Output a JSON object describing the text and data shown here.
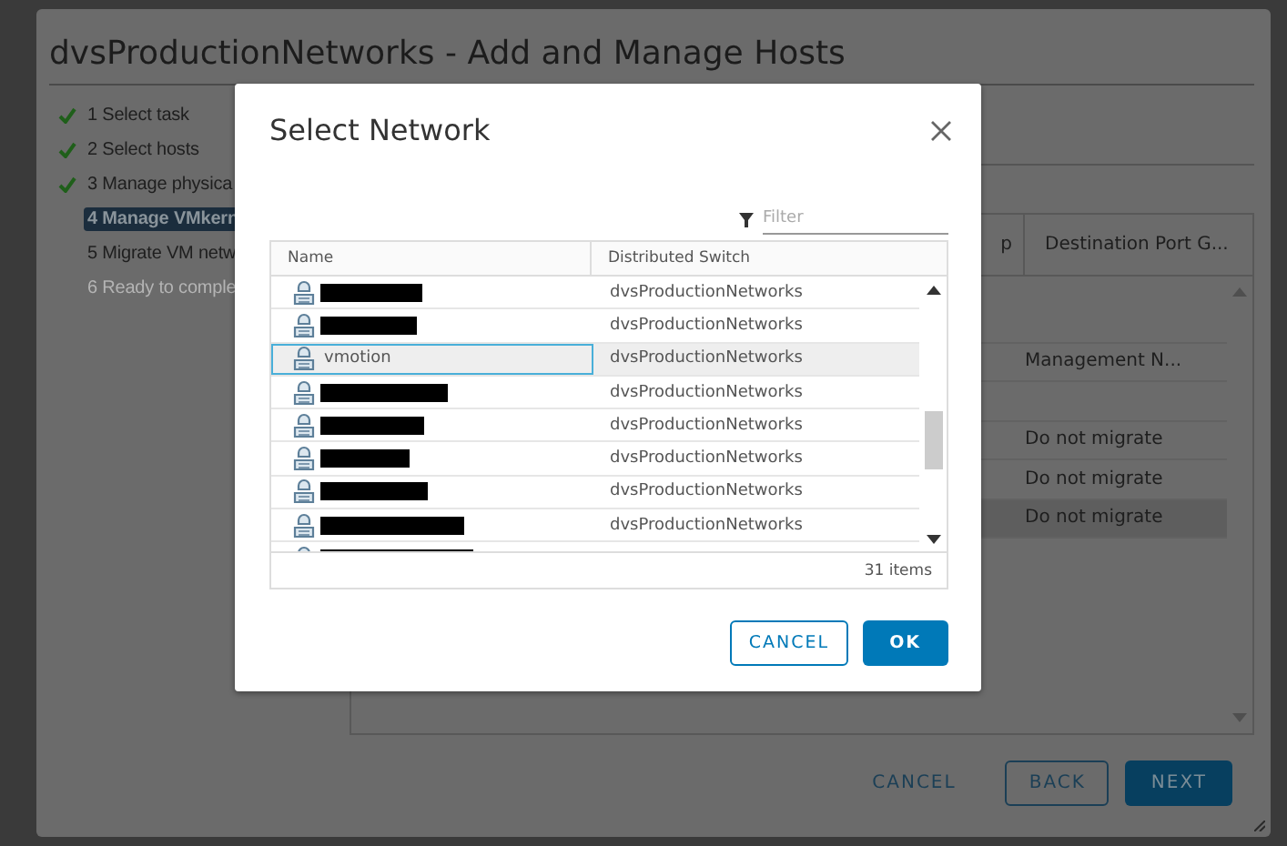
{
  "wizard": {
    "title": "dvsProductionNetworks - Add and Manage Hosts",
    "steps": [
      {
        "label": "1 Select task",
        "done": true,
        "selected": false,
        "disabled": false
      },
      {
        "label": "2 Select hosts",
        "done": true,
        "selected": false,
        "disabled": false
      },
      {
        "label": "3 Manage physica",
        "done": true,
        "selected": false,
        "disabled": false
      },
      {
        "label": "4 Manage VMkern",
        "done": false,
        "selected": true,
        "disabled": false
      },
      {
        "label": "5 Migrate VM netw",
        "done": false,
        "selected": false,
        "disabled": false
      },
      {
        "label": "6 Ready to comple",
        "done": false,
        "selected": false,
        "disabled": true
      }
    ],
    "table": {
      "columns": [
        "p",
        "Destination Port G..."
      ],
      "rows": [
        {
          "selected": false
        },
        {
          "destination": "Management N...",
          "selected": false
        },
        {
          "selected": false
        },
        {
          "destination": "Do not migrate",
          "selected": false
        },
        {
          "destination": "Do not migrate",
          "selected": false
        },
        {
          "destination": "Do not migrate",
          "selected": true
        }
      ]
    },
    "buttons": [
      {
        "label": "CANCEL",
        "kind": "flat"
      },
      {
        "label": "BACK",
        "kind": "outline"
      },
      {
        "label": "NEXT",
        "kind": "primary"
      }
    ]
  },
  "dialog": {
    "title": "Select Network",
    "filter": {
      "placeholder": "Filter"
    },
    "columns": [
      "Name",
      "Distributed Switch"
    ],
    "rows": [
      {
        "redacted": true,
        "switch": "dvsProductionNetworks",
        "selected": false
      },
      {
        "redacted": true,
        "switch": "dvsProductionNetworks",
        "selected": false
      },
      {
        "name": "vmotion",
        "redacted": false,
        "switch": "dvsProductionNetworks",
        "selected": true
      },
      {
        "redacted": true,
        "switch": "dvsProductionNetworks",
        "selected": false
      },
      {
        "redacted": true,
        "switch": "dvsProductionNetworks",
        "selected": false
      },
      {
        "redacted": true,
        "switch": "dvsProductionNetworks",
        "selected": false
      },
      {
        "redacted": true,
        "switch": "dvsProductionNetworks",
        "selected": false
      },
      {
        "redacted": true,
        "switch": "dvsProductionNetworks",
        "selected": false
      },
      {
        "redacted": true,
        "selected": false
      }
    ],
    "footer": "31 items",
    "buttons": [
      {
        "label": "CANCEL",
        "kind": "outline"
      },
      {
        "label": "OK",
        "kind": "primary"
      }
    ]
  }
}
